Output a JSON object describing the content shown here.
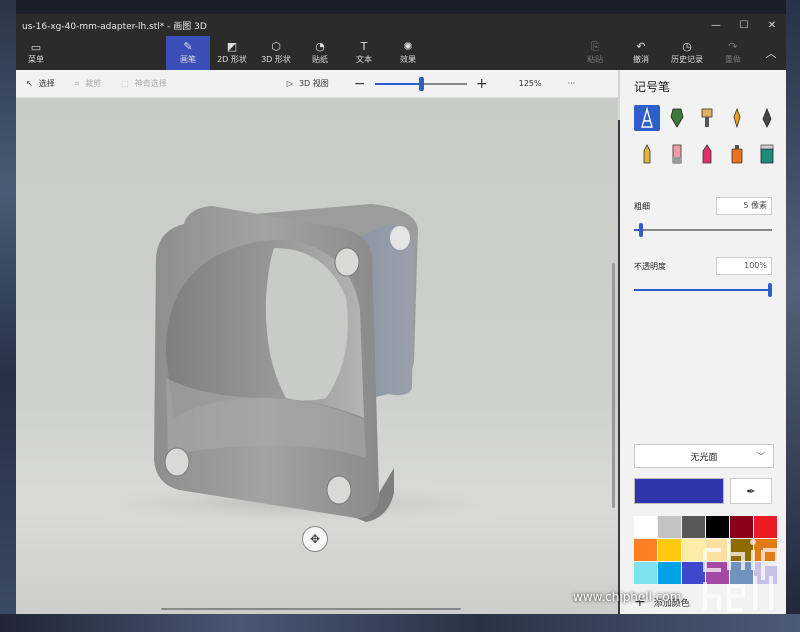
{
  "window": {
    "title": "us-16-xg-40-mm-adapter-lh.stl* - 画图 3D",
    "controls": [
      "minimize",
      "maximize",
      "close"
    ]
  },
  "toolbar": {
    "menu_label": "菜单",
    "tools": [
      {
        "label": "画笔",
        "icon": "brush-icon",
        "active": true
      },
      {
        "label": "2D 形状",
        "icon": "shapes-2d-icon"
      },
      {
        "label": "3D 形状",
        "icon": "cube-icon"
      },
      {
        "label": "贴纸",
        "icon": "sticker-icon"
      },
      {
        "label": "文本",
        "icon": "text-icon"
      },
      {
        "label": "效果",
        "icon": "effects-icon"
      },
      {
        "label": "画布",
        "icon": "canvas-icon"
      }
    ],
    "right": [
      {
        "label": "粘贴",
        "icon": "paste-icon",
        "disabled": true
      },
      {
        "label": "撤消",
        "icon": "undo-icon"
      },
      {
        "label": "历史记录",
        "icon": "history-icon"
      },
      {
        "label": "重做",
        "icon": "redo-icon",
        "disabled": true
      }
    ]
  },
  "subbar": {
    "select_label": "选择",
    "crop_label": "裁剪",
    "magic_select_label": "神奇选择",
    "view3d_label": "3D 视图",
    "zoom_value": "125%",
    "zoom_slider_fraction": 0.5,
    "more_label": "···"
  },
  "panel": {
    "title": "记号笔",
    "brushes": [
      {
        "name": "marker",
        "active": true
      },
      {
        "name": "calligraphy-pen"
      },
      {
        "name": "oil-brush"
      },
      {
        "name": "watercolor"
      },
      {
        "name": "pixel-pen"
      },
      {
        "name": "pencil"
      },
      {
        "name": "eraser"
      },
      {
        "name": "crayon"
      },
      {
        "name": "spray-can"
      },
      {
        "name": "fill"
      }
    ],
    "thickness": {
      "label": "粗细",
      "value": "5 像素",
      "fraction": 0.05
    },
    "opacity": {
      "label": "不透明度",
      "value": "100%",
      "fraction": 1.0
    },
    "finish": {
      "label": "无光面"
    },
    "current_color": "#2f35aa",
    "palette": [
      "#ffffff",
      "#c3c3c3",
      "#585858",
      "#000000",
      "#88001b",
      "#ec1c24",
      "#ff7f27",
      "#ffc90e",
      "#fdeca6",
      "#ffdfa0",
      "#8f6c00",
      "#e07b17",
      "#7fe0f0",
      "#00a2e8",
      "#3f48cc",
      "#a349a4",
      "#7092be",
      "#c8bfe7"
    ],
    "add_color_label": "添加颜色"
  },
  "watermark": {
    "url": "www.chiphell.com",
    "logo": "chiphell"
  }
}
